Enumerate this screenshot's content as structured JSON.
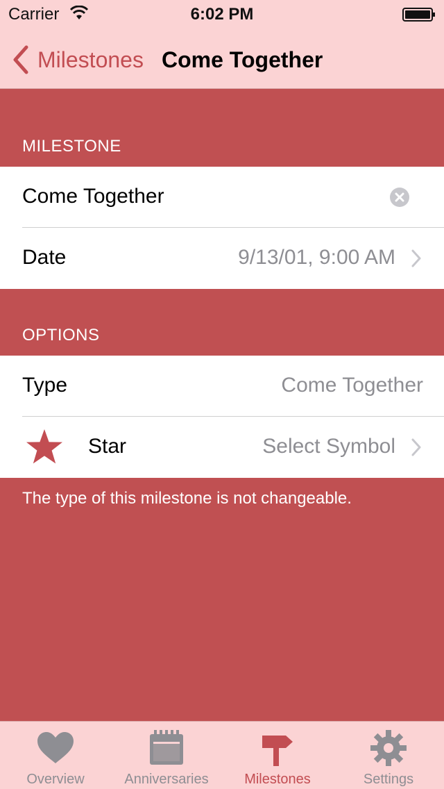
{
  "status_bar": {
    "carrier": "Carrier",
    "time": "6:02 PM"
  },
  "nav": {
    "back_label": "Milestones",
    "title": "Come Together"
  },
  "milestone_section": {
    "header": "MILESTONE",
    "name_value": "Come Together",
    "date_label": "Date",
    "date_value": "9/13/01, 9:00 AM"
  },
  "options_section": {
    "header": "OPTIONS",
    "type_label": "Type",
    "type_value": "Come Together",
    "symbol_label": "Star",
    "symbol_value": "Select Symbol",
    "footnote": "The type of this milestone is not changeable."
  },
  "tabs": [
    {
      "label": "Overview",
      "icon": "heart-icon",
      "active": false
    },
    {
      "label": "Anniversaries",
      "icon": "calendar-icon",
      "active": false
    },
    {
      "label": "Milestones",
      "icon": "signpost-icon",
      "active": true
    },
    {
      "label": "Settings",
      "icon": "gear-icon",
      "active": false
    }
  ],
  "colors": {
    "background": "#c05052",
    "bar": "#fbd3d4",
    "accent": "#c24d52",
    "secondary_text": "#8e8e93"
  }
}
